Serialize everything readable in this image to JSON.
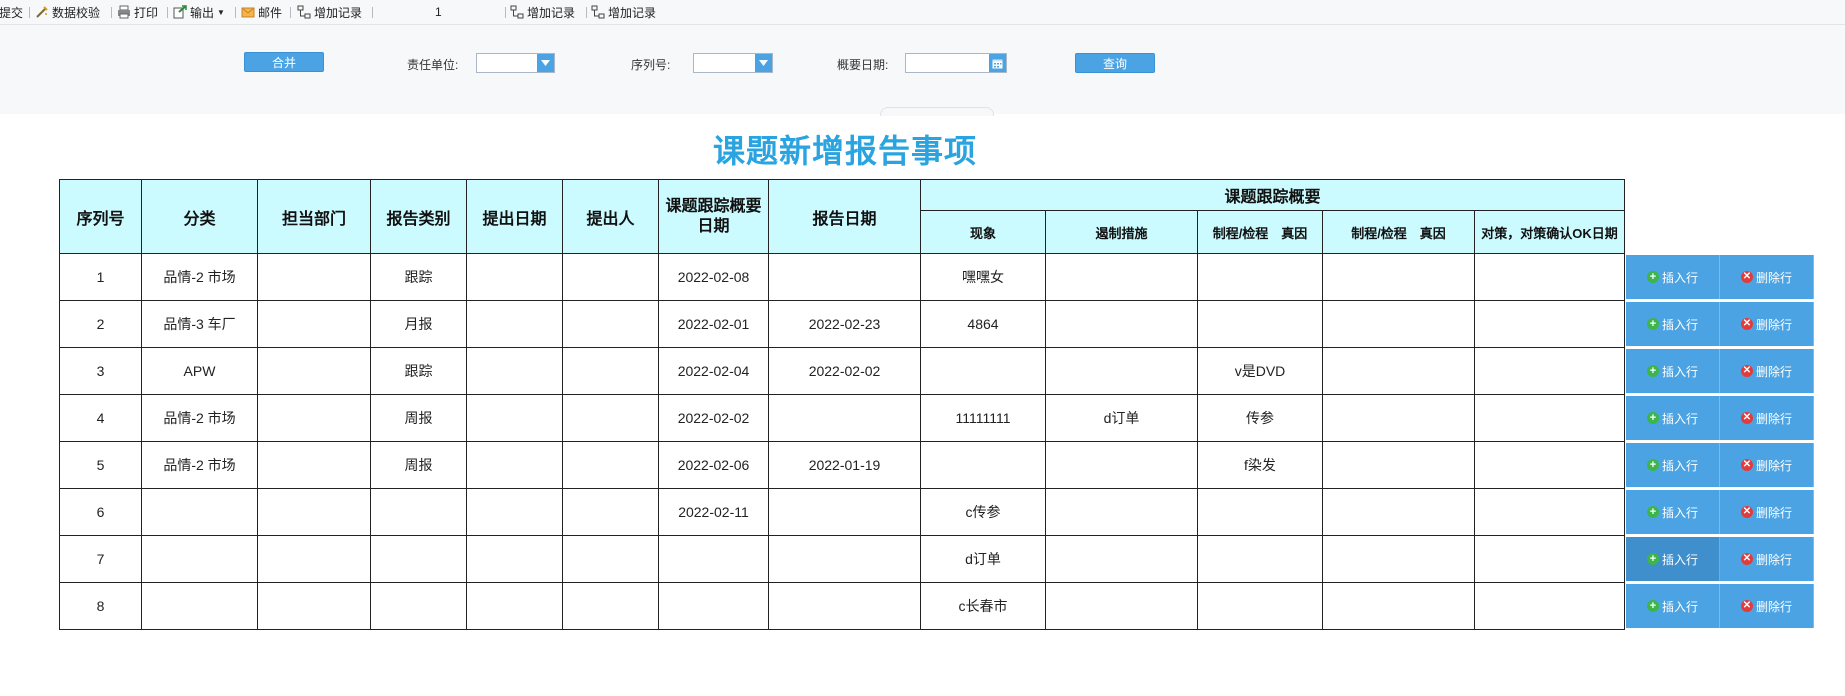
{
  "toolbar": {
    "submit": "提交",
    "validate": "数据校验",
    "print": "打印",
    "export": "输出",
    "mail": "邮件",
    "add_record_1": "增加记录",
    "page_number": "1",
    "add_record_2": "增加记录",
    "add_record_3": "增加记录"
  },
  "query": {
    "merge_button": "合并",
    "unit_label": "责任单位:",
    "unit_value": "",
    "serial_label": "序列号:",
    "serial_value": "",
    "date_label": "概要日期:",
    "date_value": "",
    "search_button": "查询"
  },
  "report": {
    "title": "课题新增报告事项",
    "headers": {
      "serial": "序列号",
      "category": "分类",
      "department": "担当部门",
      "report_type": "报告类别",
      "submit_date": "提出日期",
      "submitter": "提出人",
      "tracking_date": "课题跟踪概要日期",
      "report_date": "报告日期",
      "tracking_summary": "课题跟踪概要",
      "phenomenon": "现象",
      "containment": "遏制措施",
      "cause1": "制程/检程　真因",
      "cause2": "制程/检程　真因",
      "countermeasure": "对策，对策确认OK日期"
    },
    "rows": [
      {
        "no": "1",
        "category": "品情-2 市场",
        "dept": "",
        "type": "跟踪",
        "submit_date": "",
        "submitter": "",
        "tracking_date": "2022-02-08",
        "report_date": "",
        "phenomenon": "嘿嘿女",
        "containment": "",
        "cause1": "",
        "cause2": "",
        "countermeasure": ""
      },
      {
        "no": "2",
        "category": "品情-3 车厂",
        "dept": "",
        "type": "月报",
        "submit_date": "",
        "submitter": "",
        "tracking_date": "2022-02-01",
        "report_date": "2022-02-23",
        "phenomenon": "4864",
        "containment": "",
        "cause1": "",
        "cause2": "",
        "countermeasure": ""
      },
      {
        "no": "3",
        "category": "APW",
        "dept": "",
        "type": "跟踪",
        "submit_date": "",
        "submitter": "",
        "tracking_date": "2022-02-04",
        "report_date": "2022-02-02",
        "phenomenon": "",
        "containment": "",
        "cause1": "v是DVD",
        "cause2": "",
        "countermeasure": ""
      },
      {
        "no": "4",
        "category": "品情-2 市场",
        "dept": "",
        "type": "周报",
        "submit_date": "",
        "submitter": "",
        "tracking_date": "2022-02-02",
        "report_date": "",
        "phenomenon": "11111111",
        "containment": "d订单",
        "cause1": "传参",
        "cause2": "",
        "countermeasure": ""
      },
      {
        "no": "5",
        "category": "品情-2 市场",
        "dept": "",
        "type": "周报",
        "submit_date": "",
        "submitter": "",
        "tracking_date": "2022-02-06",
        "report_date": "2022-01-19",
        "phenomenon": "",
        "containment": "",
        "cause1": "f染发",
        "cause2": "",
        "countermeasure": ""
      },
      {
        "no": "6",
        "category": "",
        "dept": "",
        "type": "",
        "submit_date": "",
        "submitter": "",
        "tracking_date": "2022-02-11",
        "report_date": "",
        "phenomenon": "c传参",
        "containment": "",
        "cause1": "",
        "cause2": "",
        "countermeasure": ""
      },
      {
        "no": "7",
        "category": "",
        "dept": "",
        "type": "",
        "submit_date": "",
        "submitter": "",
        "tracking_date": "",
        "report_date": "",
        "phenomenon": "d订单",
        "containment": "",
        "cause1": "",
        "cause2": "",
        "countermeasure": ""
      },
      {
        "no": "8",
        "category": "",
        "dept": "",
        "type": "",
        "submit_date": "",
        "submitter": "",
        "tracking_date": "",
        "report_date": "",
        "phenomenon": "c长春市",
        "containment": "",
        "cause1": "",
        "cause2": "",
        "countermeasure": ""
      }
    ],
    "insert_label": "插入行",
    "delete_label": "删除行"
  },
  "colors": {
    "accent": "#4ba3e3",
    "title": "#2aa4e0",
    "header_bg": "#ccfbff",
    "insert_icon": "#3cb54a",
    "delete_icon": "#e23b3b"
  },
  "icons": [
    "validate-icon",
    "print-icon",
    "export-icon",
    "mail-icon",
    "add-record-icon",
    "dropdown-arrow-icon",
    "calendar-icon",
    "plus-icon",
    "delete-icon"
  ]
}
